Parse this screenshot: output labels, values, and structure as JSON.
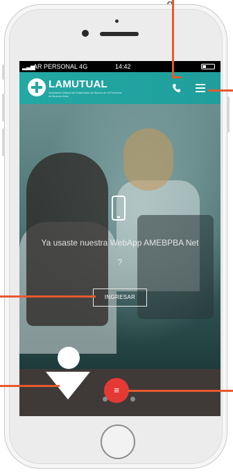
{
  "caption": {
    "text": "g"
  },
  "status_bar": {
    "signal": "▂▃▅",
    "carrier": "AR PERSONAL 4G",
    "time": "14:42"
  },
  "header": {
    "logo_title": "LAMUTUAL",
    "logo_subtitle": "Asociación Mutual de Empleados del Banco de la Provincia de Buenos Aires"
  },
  "hero": {
    "question": "Ya usaste nuestra WebApp AMEBPBA Net ?",
    "button_label": "INGRESAR"
  },
  "fab": {
    "icon": "≡"
  },
  "colors": {
    "header_teal": "#23a8a4",
    "fab_red": "#e53935",
    "callout_orange": "#e8582f",
    "bottom_bar": "#3f3a38"
  },
  "icons": [
    "phone-icon",
    "menu-icon",
    "mobile-icon",
    "fab-menu-icon"
  ]
}
